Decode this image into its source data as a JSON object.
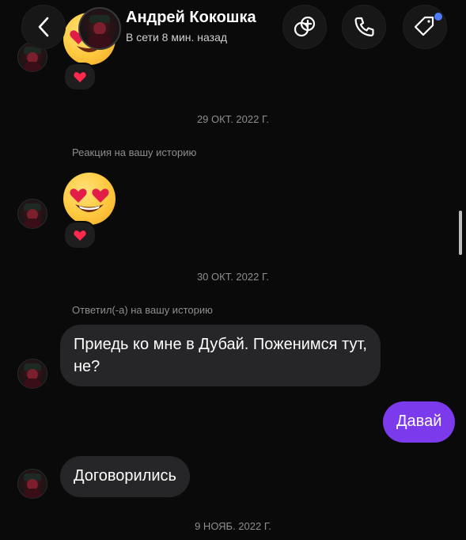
{
  "header": {
    "name": "Андрей Кокошка",
    "status": "В сети 8 мин. назад"
  },
  "dates": [
    "29 ОКТ. 2022 Г.",
    "30 ОКТ. 2022 Г.",
    "9 НОЯБ. 2022 Г."
  ],
  "captions": {
    "story_reaction": "Реакция на вашу историю",
    "story_reply": "Ответил(-а) на вашу историю"
  },
  "messages": {
    "incoming_1": "Приедь ко мне в Дубай. Поженимся тут, не?",
    "outgoing_1": "Давай",
    "incoming_2": "Договорились"
  },
  "colors": {
    "background": "#0a0a0a",
    "bubble_incoming": "#262628",
    "bubble_outgoing": "#7c3aed",
    "muted_text": "#8e8e93",
    "notification_dot": "#4f7cff",
    "heart": "#ff2a4b"
  },
  "icons": {
    "back": "chevron-left-icon",
    "add_to_group": "add-person-icon",
    "call": "phone-icon",
    "tag": "tag-icon",
    "reaction": "heart-icon",
    "emoji": "heart-eyes-emoji"
  }
}
